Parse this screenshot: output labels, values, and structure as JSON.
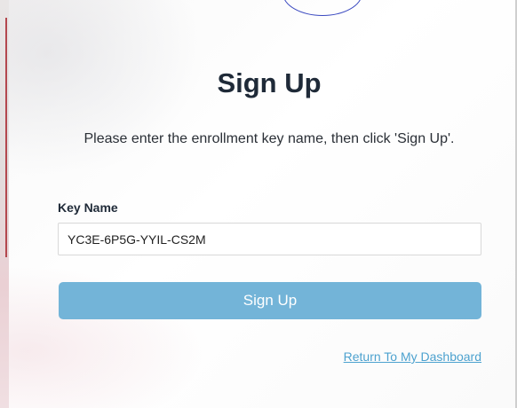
{
  "form": {
    "title": "Sign Up",
    "instructions": "Please enter the enrollment key name, then click 'Sign Up'.",
    "key_name_label": "Key Name",
    "key_name_value": "YC3E-6P5G-YYIL-CS2M",
    "submit_label": "Sign Up",
    "dashboard_link": "Return To My Dashboard"
  },
  "colors": {
    "accent_button": "#73b4d8",
    "link": "#4da2cf",
    "title_text": "#1f2a38",
    "logo_arc": "#3a49c0"
  }
}
